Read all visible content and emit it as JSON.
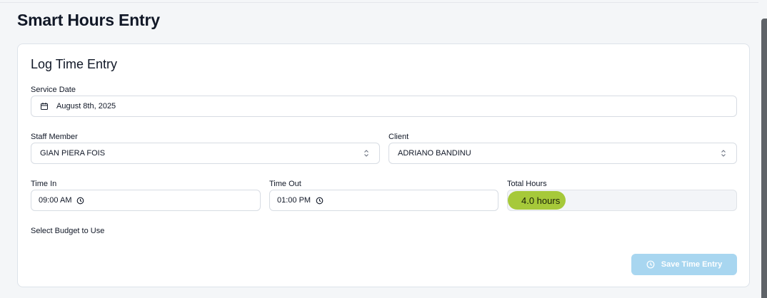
{
  "page": {
    "title": "Smart Hours Entry"
  },
  "card": {
    "title": "Log Time Entry",
    "service_date": {
      "label": "Service Date",
      "value": "August 8th, 2025"
    },
    "staff_member": {
      "label": "Staff Member",
      "value": "GIAN PIERA FOIS"
    },
    "client": {
      "label": "Client",
      "value": "ADRIANO BANDINU"
    },
    "time_in": {
      "label": "Time In",
      "value": "09:00 AM"
    },
    "time_out": {
      "label": "Time Out",
      "value": "01:00 PM"
    },
    "total_hours": {
      "label": "Total Hours",
      "value": "4.0 hours"
    },
    "budget": {
      "label": "Select Budget to Use"
    },
    "save_button": {
      "label": "Save Time Entry"
    }
  },
  "icons": {
    "date": "calendar-icon",
    "select": "chevron-up-down-icon",
    "time": "clock-icon",
    "save": "clock-icon"
  },
  "colors": {
    "accent_total": "#a6c93a",
    "save_button_disabled": "#a8d6f0"
  }
}
